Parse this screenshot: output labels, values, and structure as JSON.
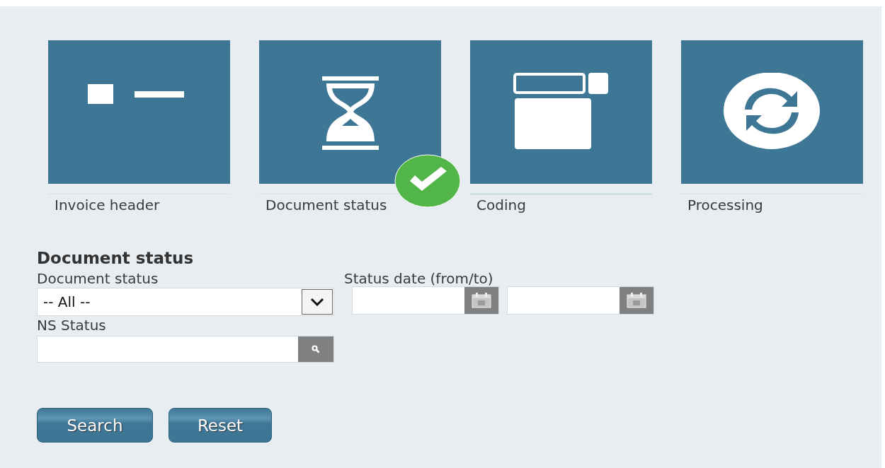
{
  "steps": [
    {
      "label": "Invoice header",
      "kind": "header",
      "completed": false,
      "selected": false
    },
    {
      "label": "Document status",
      "kind": "hourglass",
      "completed": true,
      "selected": false
    },
    {
      "label": "Coding",
      "kind": "coding",
      "completed": false,
      "selected": true
    },
    {
      "label": "Processing",
      "kind": "sync",
      "completed": false,
      "selected": false
    }
  ],
  "form": {
    "title": "Document status",
    "document_status": {
      "label": "Document status",
      "value": "-- All --"
    },
    "status_date": {
      "label": "Status date (from/to)"
    },
    "ns_status": {
      "label": "NS Status"
    }
  },
  "buttons": [
    "Search",
    "Reset"
  ]
}
